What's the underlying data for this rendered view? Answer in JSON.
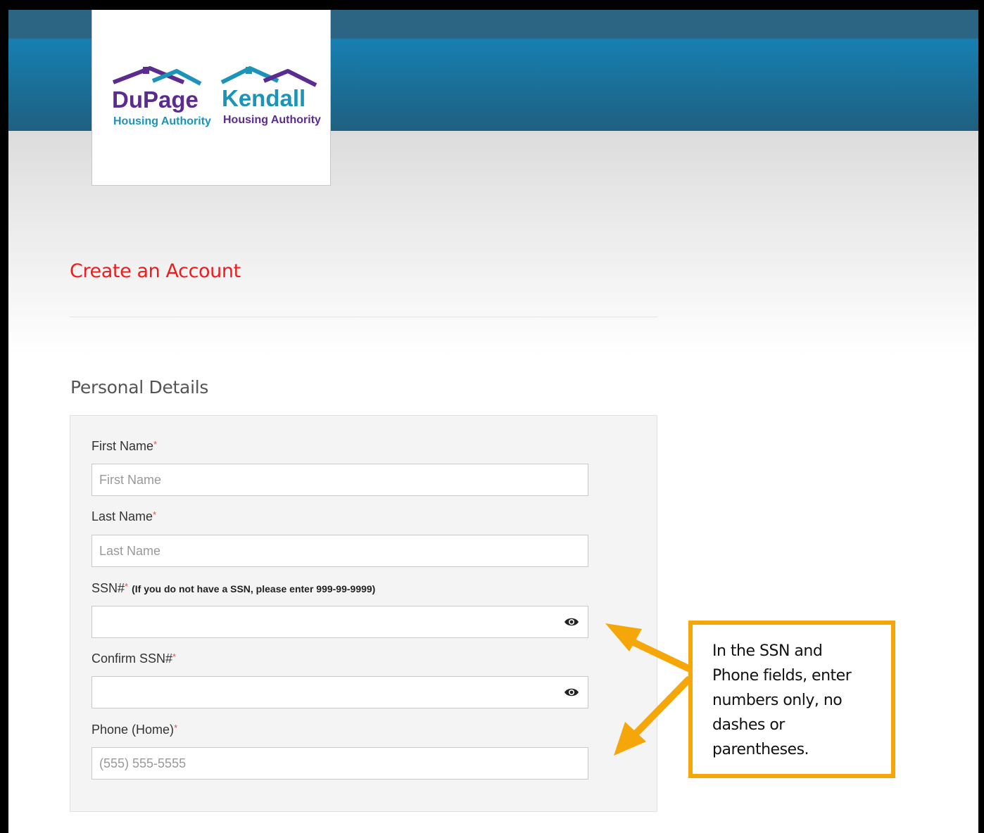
{
  "logo": {
    "left_name": "DuPage",
    "left_sub": "Housing Authority",
    "right_name": "Kendall",
    "right_sub": "Housing Authority"
  },
  "page_title": "Create an Account",
  "section_title": "Personal Details",
  "form": {
    "first_name": {
      "label": "First Name",
      "required_mark": "*",
      "placeholder": "First Name",
      "value": ""
    },
    "last_name": {
      "label": "Last Name",
      "required_mark": "*",
      "placeholder": "Last Name",
      "value": ""
    },
    "ssn": {
      "label": "SSN#",
      "required_mark": "*",
      "hint": "(If you do not have a SSN, please enter 999-99-9999)",
      "value": ""
    },
    "confirm_ssn": {
      "label": "Confirm SSN#",
      "required_mark": "*",
      "value": ""
    },
    "phone_home": {
      "label": "Phone (Home)",
      "required_mark": "*",
      "placeholder": "(555) 555-5555",
      "value": ""
    }
  },
  "callout": {
    "lines": [
      "In the SSN and",
      "Phone fields, enter",
      "numbers only, no",
      "dashes or",
      "parentheses."
    ]
  },
  "colors": {
    "header_blue": "#177fb1",
    "title_red": "#ee1c1c",
    "callout_orange": "#f5a70a",
    "dupage_purple": "#5b2b8f",
    "kendall_teal": "#1c93b8"
  },
  "icons": {
    "ssn_toggle": "eye-icon",
    "confirm_ssn_toggle": "eye-icon"
  }
}
